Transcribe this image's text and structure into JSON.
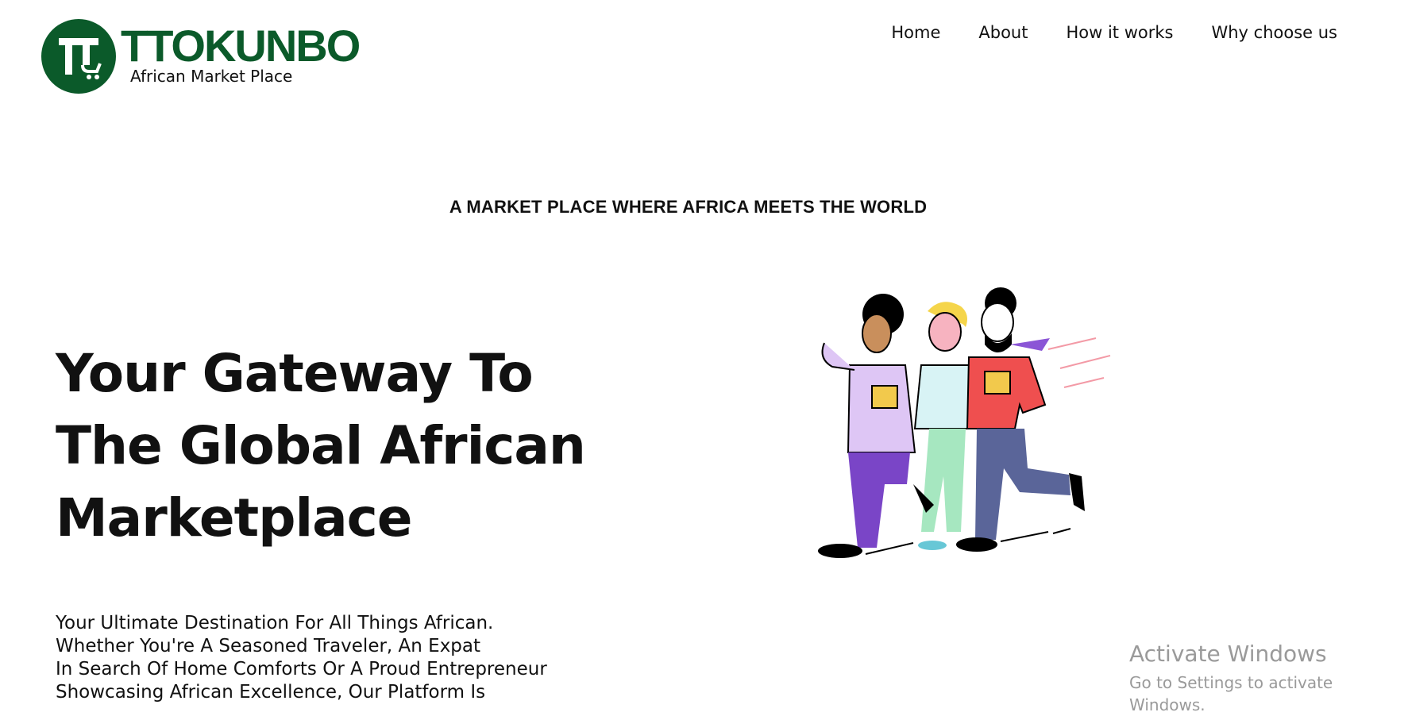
{
  "logo": {
    "brand": "TTOKUNBO",
    "subtitle": "African Market Place",
    "brand_color": "#0b5a2a"
  },
  "nav": {
    "items": [
      "Home",
      "About",
      "How it works",
      "Why choose us"
    ]
  },
  "hero": {
    "tagline": "A MARKET PLACE WHERE AFRICA MEETS THE WORLD",
    "headline_lines": [
      "Your Gateway To",
      "The Global African",
      "Marketplace"
    ],
    "description_lines": [
      "Your Ultimate Destination For All Things African.",
      "Whether You're A Seasoned Traveler, An Expat",
      "In Search Of Home Comforts Or A Proud Entrepreneur",
      "Showcasing African Excellence, Our Platform Is"
    ]
  },
  "watermark": {
    "title": "Activate Windows",
    "subtitle": "Go to Settings to activate Windows."
  }
}
